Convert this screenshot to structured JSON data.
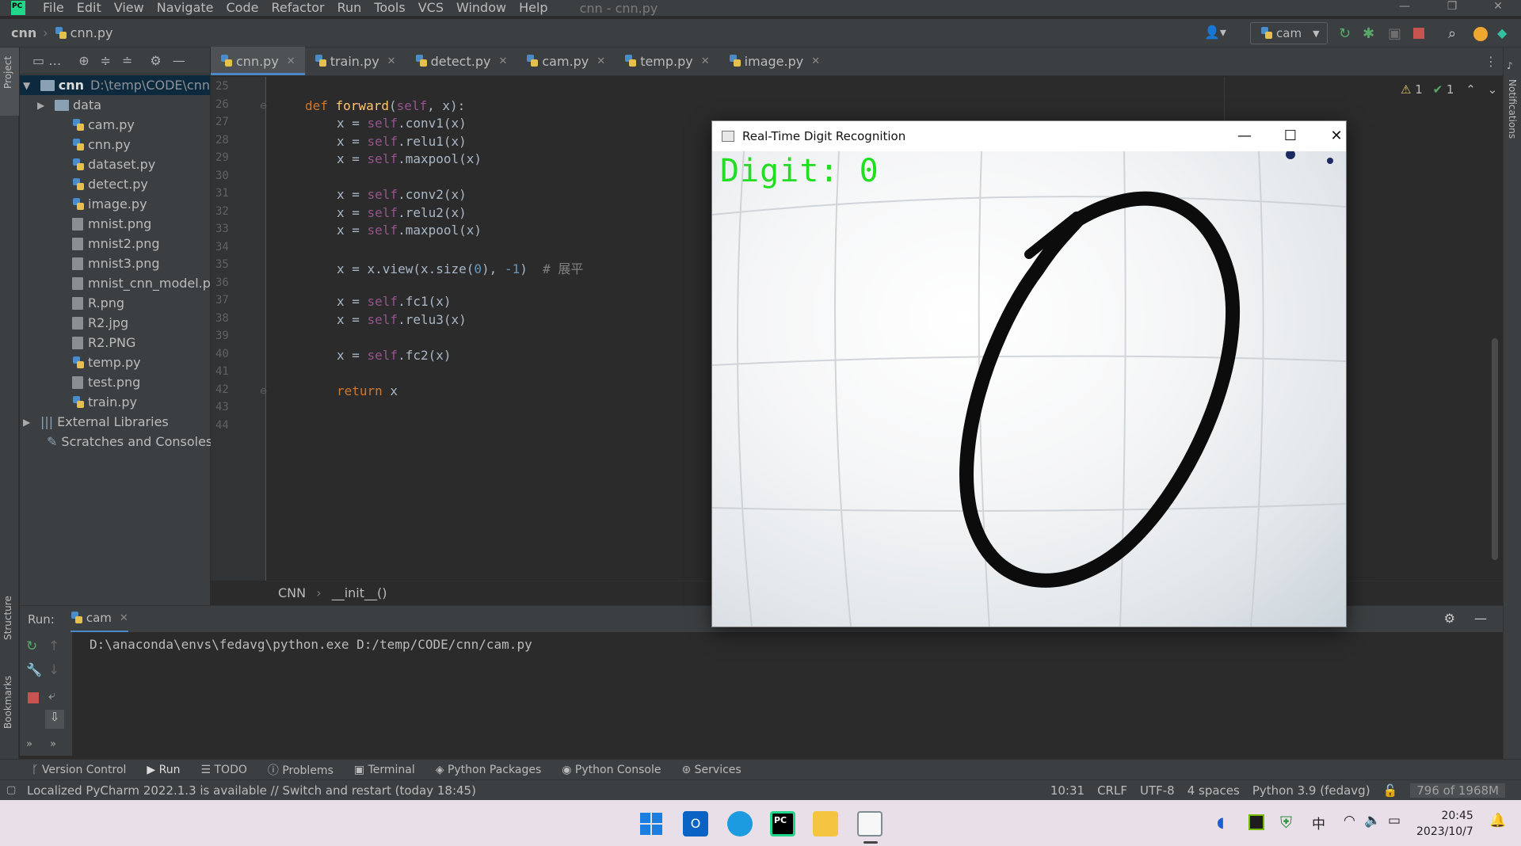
{
  "menubar": {
    "items": [
      "File",
      "Edit",
      "View",
      "Navigate",
      "Code",
      "Refactor",
      "Run",
      "Tools",
      "VCS",
      "Window",
      "Help"
    ],
    "window_title": "cnn - cnn.py"
  },
  "navbar": {
    "project": "cnn",
    "file": "cnn.py",
    "run_config": "cam"
  },
  "project_panel": {
    "label": "Project",
    "root_name": "cnn",
    "root_path": "D:\\temp\\CODE\\cnn",
    "items": [
      {
        "name": "data",
        "kind": "folder"
      },
      {
        "name": "cam.py",
        "kind": "py"
      },
      {
        "name": "cnn.py",
        "kind": "py"
      },
      {
        "name": "dataset.py",
        "kind": "py"
      },
      {
        "name": "detect.py",
        "kind": "py"
      },
      {
        "name": "image.py",
        "kind": "py"
      },
      {
        "name": "mnist.png",
        "kind": "file"
      },
      {
        "name": "mnist2.png",
        "kind": "file"
      },
      {
        "name": "mnist3.png",
        "kind": "file"
      },
      {
        "name": "mnist_cnn_model.pth",
        "kind": "file"
      },
      {
        "name": "R.png",
        "kind": "file"
      },
      {
        "name": "R2.jpg",
        "kind": "file"
      },
      {
        "name": "R2.PNG",
        "kind": "file"
      },
      {
        "name": "temp.py",
        "kind": "py"
      },
      {
        "name": "test.png",
        "kind": "file"
      },
      {
        "name": "train.py",
        "kind": "py"
      }
    ],
    "external_libraries": "External Libraries",
    "scratches": "Scratches and Consoles"
  },
  "editor": {
    "tabs": [
      "cnn.py",
      "train.py",
      "detect.py",
      "cam.py",
      "temp.py",
      "image.py"
    ],
    "active_tab": "cnn.py",
    "line_numbers": [
      "25",
      "26",
      "27",
      "28",
      "29",
      "30",
      "31",
      "32",
      "33",
      "34",
      "35",
      "36",
      "37",
      "38",
      "39",
      "40",
      "41",
      "42",
      "43",
      "44"
    ],
    "code": {
      "l26_kw": "def ",
      "l26_fn": "forward",
      "l26_p1": "(",
      "l26_self": "self",
      "l26_p2": ", x):",
      "l27": "conv1(x)",
      "l28": "relu1(x)",
      "l29": "maxpool(x)",
      "l31": "conv2(x)",
      "l32": "relu2(x)",
      "l33": "maxpool(x)",
      "l35_a": "x = x.view(x.size(",
      "l35_n0": "0",
      "l35_b": "), ",
      "l35_n1": "-1",
      "l35_c": ")  ",
      "l35_cmt": "# 展平",
      "l37": "fc1(x)",
      "l38": "relu3(x)",
      "l40": "fc2(x)",
      "l42_kw": "return",
      "l42_rest": " x",
      "assign": "x = ",
      "self": "self",
      "dot": "."
    },
    "inspections": {
      "warnings": "1",
      "ok": "1"
    },
    "breadcrumb": [
      "CNN",
      "__init__()"
    ]
  },
  "run_panel": {
    "label": "Run:",
    "tab": "cam",
    "command": "D:\\anaconda\\envs\\fedavg\\python.exe D:/temp/CODE/cnn/cam.py"
  },
  "tool_windows": [
    "Version Control",
    "Run",
    "TODO",
    "Problems",
    "Terminal",
    "Python Packages",
    "Python Console",
    "Services"
  ],
  "side_labels": {
    "structure": "Structure",
    "bookmarks": "Bookmarks",
    "notifications": "Notifications"
  },
  "statusbar": {
    "message": "Localized PyCharm 2022.1.3 is available // Switch and restart (today 18:45)",
    "position": "10:31",
    "line_sep": "CRLF",
    "encoding": "UTF-8",
    "indent": "4 spaces",
    "interpreter": "Python 3.9 (fedavg)",
    "memory": "796 of 1968M"
  },
  "cv_window": {
    "title": "Real-Time Digit Recognition",
    "overlay_text": "Digit:  0",
    "stroke_color": "#0c0c0c",
    "overlay_color": "#22dd22"
  },
  "taskbar": {
    "time": "20:45",
    "date": "2023/10/7",
    "ime": "中"
  },
  "colors": {
    "accent": "#4a88c7",
    "editor_bg": "#2b2b2b",
    "panel_bg": "#3c3f41"
  }
}
